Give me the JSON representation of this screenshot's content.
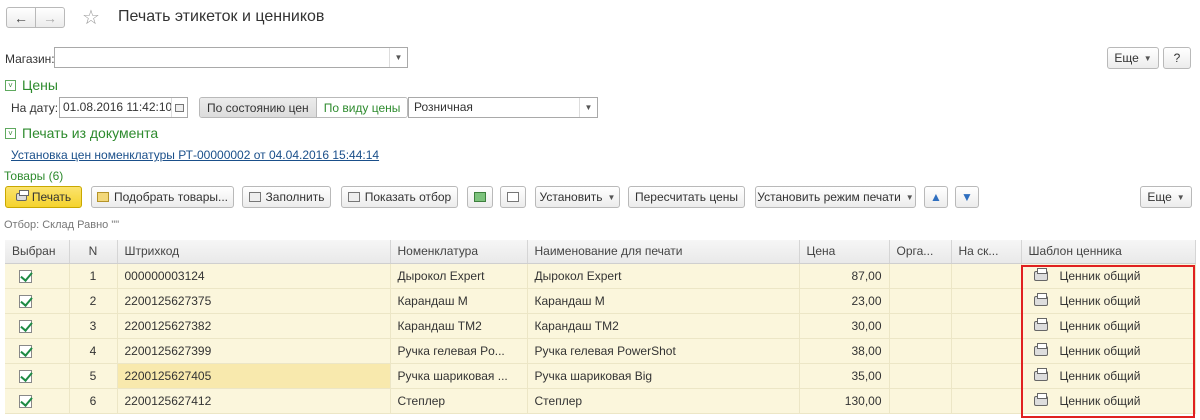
{
  "header": {
    "back_icon": "arrow-left-icon",
    "forward_icon": "arrow-right-icon",
    "favorite_icon": "star-icon",
    "title": "Печать этикеток и ценников"
  },
  "store": {
    "label": "Магазин:",
    "value": ""
  },
  "more_button": "Еще",
  "help_button": "?",
  "prices_group": {
    "title": "Цены",
    "date_label": "На дату:",
    "date_value": "01.08.2016 11:42:10",
    "mode_by_state": "По состоянию цен",
    "mode_by_type": "По виду цены",
    "price_type": "Розничная"
  },
  "doc_group": {
    "title": "Печать из документа",
    "doc_link": "Установка цен номенклатуры РТ-00000002 от 04.04.2016 15:44:14"
  },
  "goods": {
    "title": "Товары (6)",
    "filter_text": "Отбор: Склад Равно \"\"",
    "toolbar": {
      "print": "Печать",
      "pick": "Подобрать товары...",
      "fill": "Заполнить",
      "show_filter": "Показать отбор",
      "set": "Установить",
      "recalc": "Пересчитать цены",
      "set_print_mode": "Установить режим печати",
      "more": "Еще"
    },
    "columns": [
      "Выбран",
      "N",
      "Штрихкод",
      "Номенклатура",
      "Наименование для печати",
      "Цена",
      "Орга...",
      "На ск...",
      "Шаблон ценника"
    ],
    "rows": [
      {
        "n": "1",
        "barcode": "000000003124",
        "item": "Дырокол Expert",
        "print_name": "Дырокол Expert",
        "price": "87,00",
        "org": "",
        "stock": "",
        "template": "Ценник общий"
      },
      {
        "n": "2",
        "barcode": "2200125627375",
        "item": "Карандаш М",
        "print_name": "Карандаш М",
        "price": "23,00",
        "org": "",
        "stock": "",
        "template": "Ценник общий"
      },
      {
        "n": "3",
        "barcode": "2200125627382",
        "item": "Карандаш ТМ2",
        "print_name": "Карандаш ТМ2",
        "price": "30,00",
        "org": "",
        "stock": "",
        "template": "Ценник общий"
      },
      {
        "n": "4",
        "barcode": "2200125627399",
        "item": "Ручка гелевая Po...",
        "print_name": "Ручка гелевая PowerShot",
        "price": "38,00",
        "org": "",
        "stock": "",
        "template": "Ценник общий"
      },
      {
        "n": "5",
        "barcode": "2200125627405",
        "item": "Ручка шариковая ...",
        "print_name": "Ручка шариковая Big",
        "price": "35,00",
        "org": "",
        "stock": "",
        "template": "Ценник общий"
      },
      {
        "n": "6",
        "barcode": "2200125627412",
        "item": "Степлер",
        "print_name": "Степлер",
        "price": "130,00",
        "org": "",
        "stock": "",
        "template": "Ценник общий"
      }
    ]
  },
  "colors": {
    "accent_green": "#2e8b2e",
    "link_blue": "#1a4f8a",
    "row_bg": "#fbf6dc",
    "print_button": "#f5d32d",
    "highlight_red": "#e02020"
  }
}
